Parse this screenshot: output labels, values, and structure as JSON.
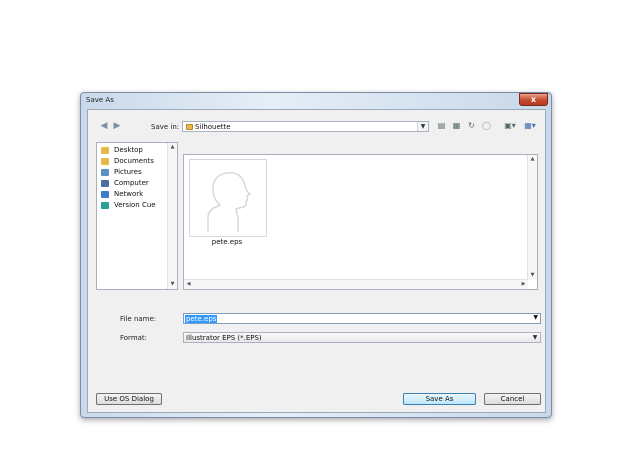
{
  "window": {
    "title": "Save As",
    "close_label": "x"
  },
  "toolbar": {
    "back_icon": "back-arrow-icon",
    "forward_icon": "forward-arrow-icon",
    "save_in_label": "Save in:",
    "save_in_value": "Silhouette"
  },
  "places": [
    {
      "label": "Desktop",
      "icon": "folder-icon",
      "color": "#e7b94a"
    },
    {
      "label": "Documents",
      "icon": "folder-icon",
      "color": "#e7b94a"
    },
    {
      "label": "Pictures",
      "icon": "pictures-icon",
      "color": "#5b8fc7"
    },
    {
      "label": "Computer",
      "icon": "computer-icon",
      "color": "#4a6fa5"
    },
    {
      "label": "Network",
      "icon": "network-icon",
      "color": "#3f7cc4"
    },
    {
      "label": "Version Cue",
      "icon": "version-cue-icon",
      "color": "#2aa198"
    }
  ],
  "files": [
    {
      "name": "pete.eps",
      "icon": "silhouette-thumbnail-icon"
    }
  ],
  "form": {
    "filename_label": "File name:",
    "filename_value": "pete.eps",
    "format_label": "Format:",
    "format_value": "Illustrator EPS (*.EPS)"
  },
  "buttons": {
    "os_dialog": "Use OS Dialog",
    "save": "Save As",
    "cancel": "Cancel"
  },
  "colors": {
    "selection": "#3399ff",
    "primary_button": "#bee6fd"
  }
}
